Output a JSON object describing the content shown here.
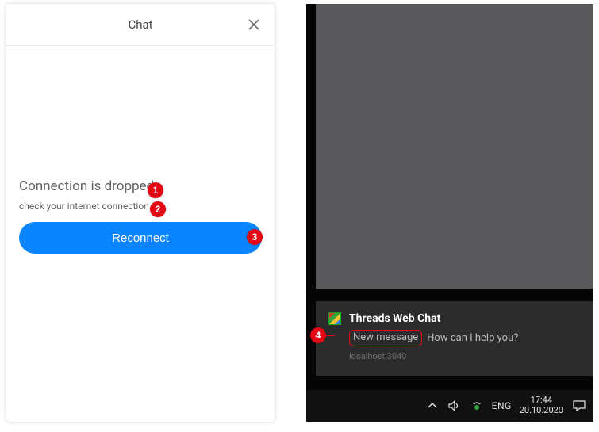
{
  "chat": {
    "title": "Chat",
    "error_heading": "Connection is dropped",
    "error_sub": "check your internet connection",
    "reconnect_label": "Reconnect"
  },
  "toast": {
    "app_title": "Threads Web Chat",
    "new_message_label": "New message",
    "preview": "How can I help you?",
    "origin": "localhost:3040"
  },
  "taskbar": {
    "lang": "ENG",
    "time": "17:44",
    "date": "20.10.2020"
  },
  "annotations": {
    "b1": "1",
    "b2": "2",
    "b3": "3",
    "b4": "4"
  }
}
